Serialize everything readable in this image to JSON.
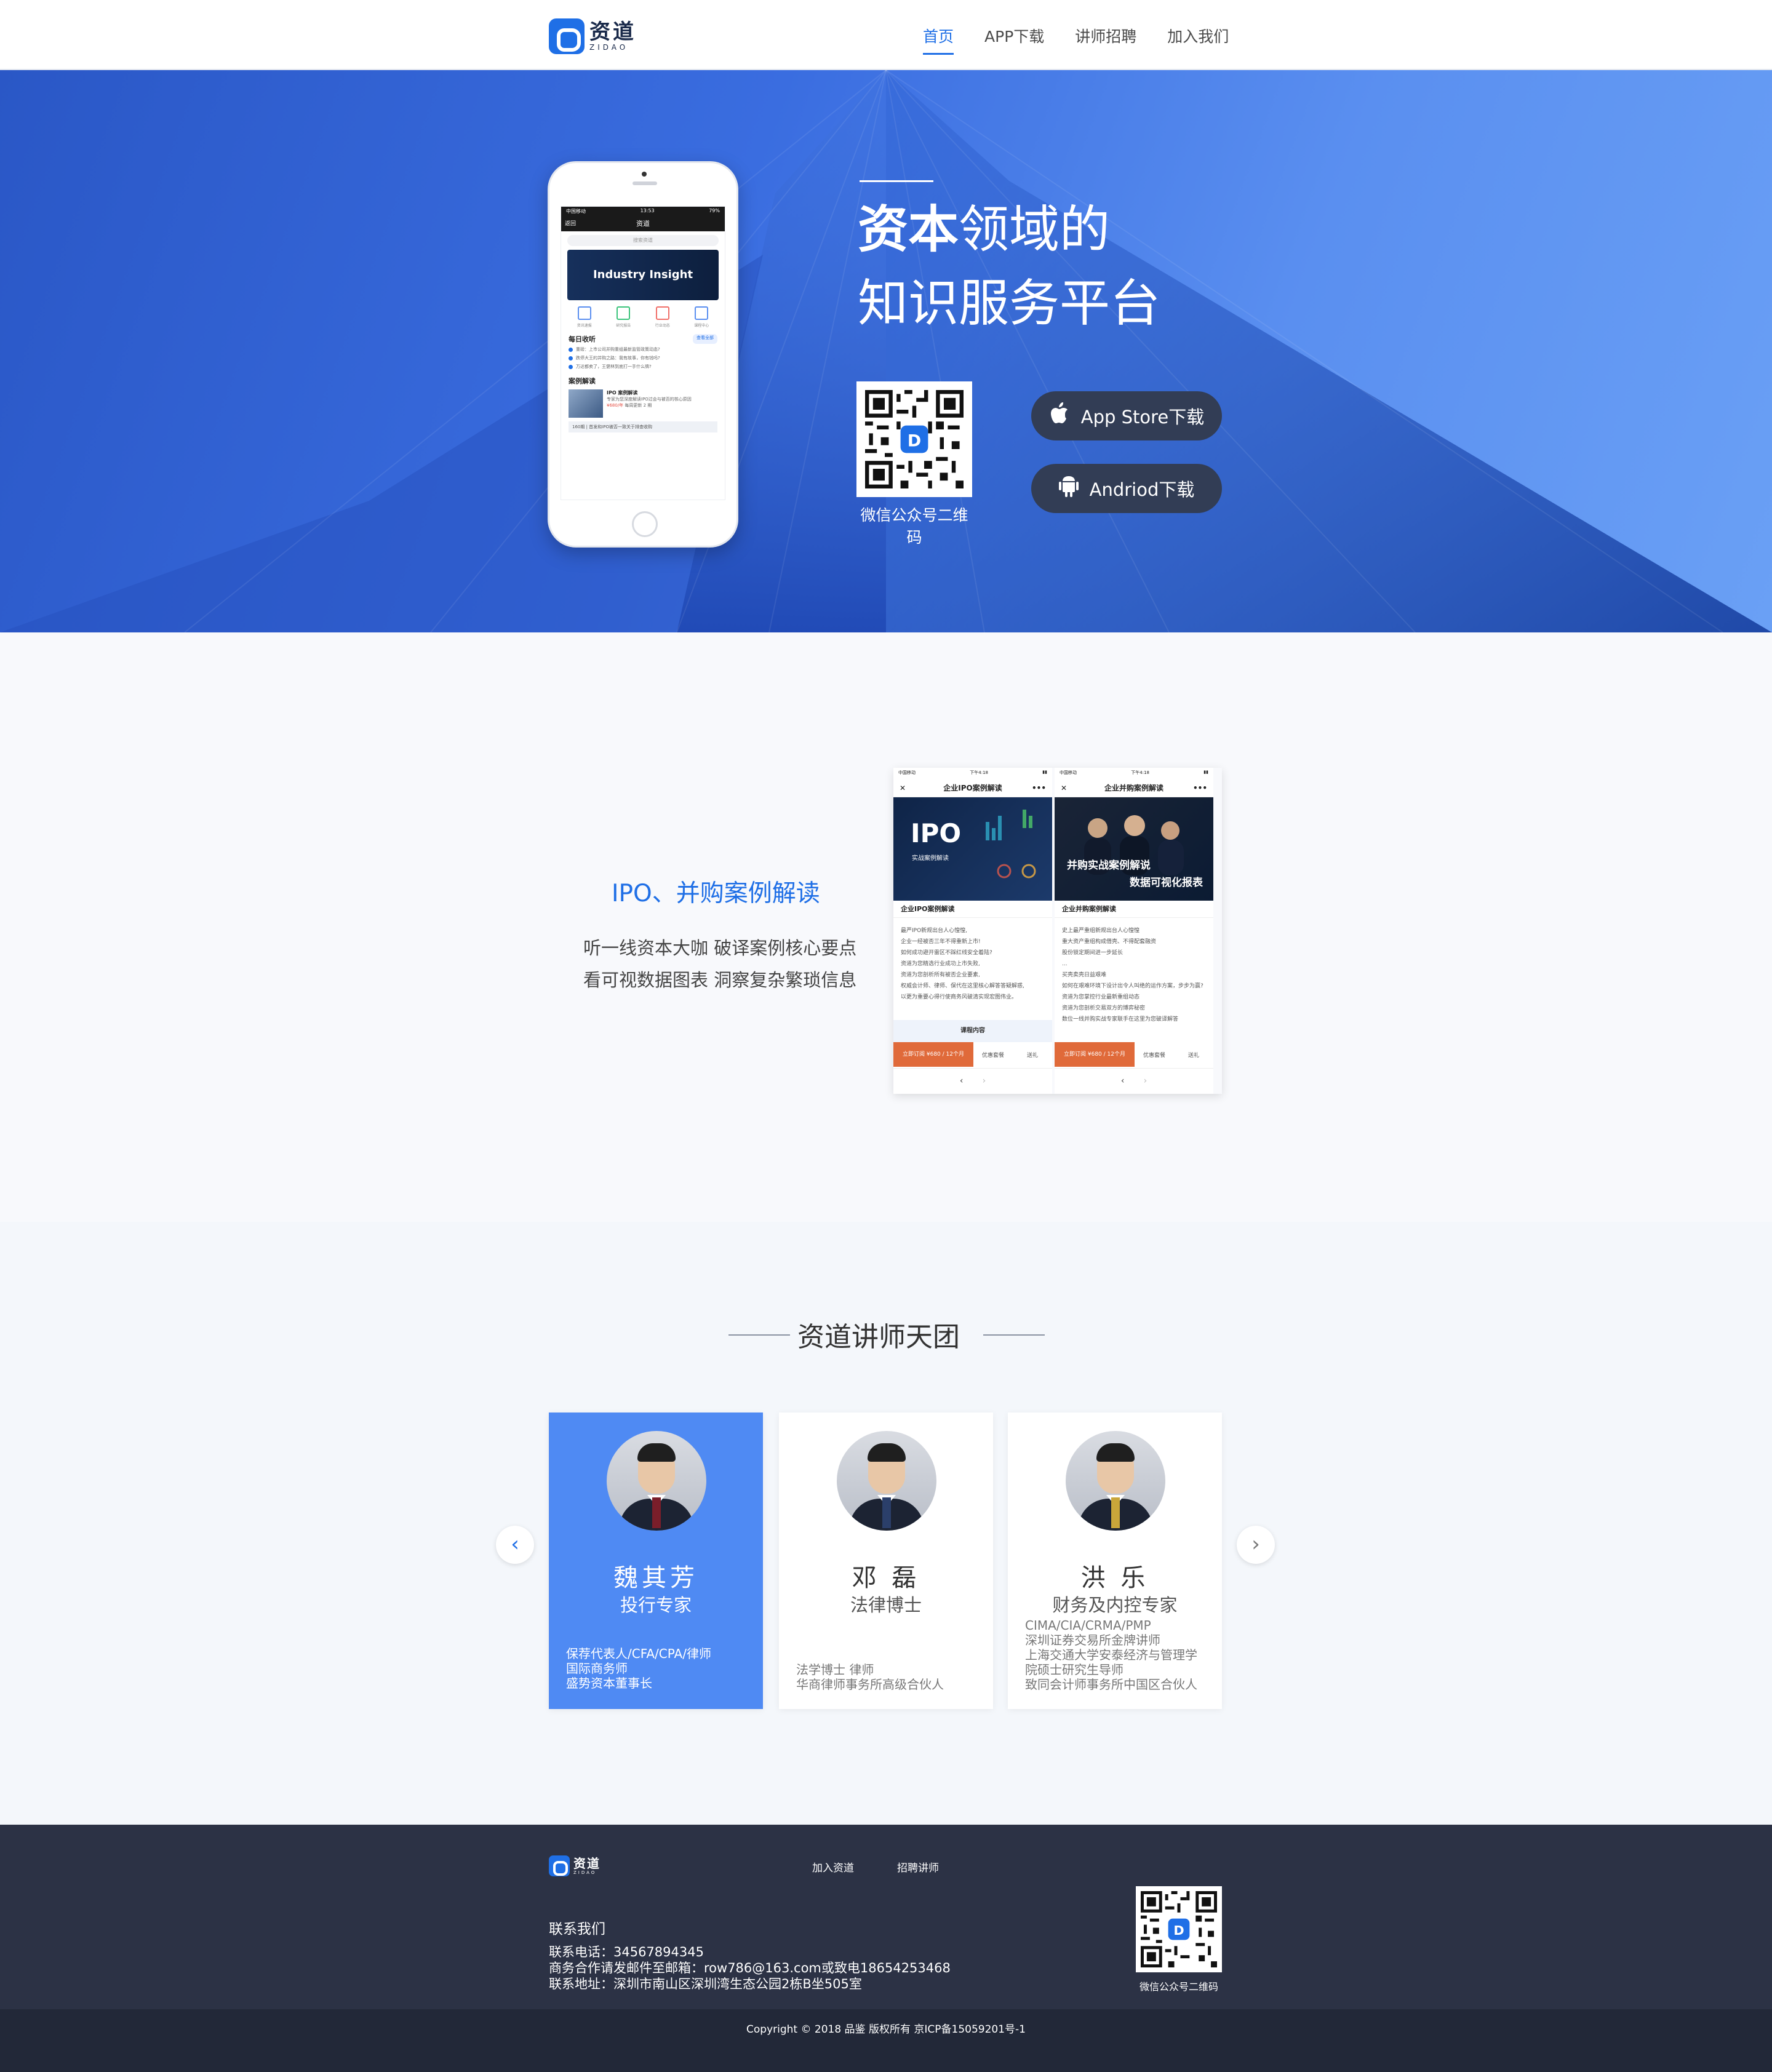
{
  "brand": {
    "name_cn": "资道",
    "name_en": "ZIDAO"
  },
  "nav": {
    "items": [
      {
        "label": "首页",
        "active": true
      },
      {
        "label": "APP下载"
      },
      {
        "label": "讲师招聘"
      },
      {
        "label": "加入我们"
      }
    ]
  },
  "hero": {
    "title_bold": "资本",
    "title_rest": "领域的",
    "title_line2": "知识服务平台",
    "qr_caption": "微信公众号二维码",
    "ios_button": "App Store下载",
    "android_button": "Andriod下载",
    "phone": {
      "status_left": "中国移动",
      "status_mid": "13:53",
      "status_right": "79%",
      "back": "返回",
      "title": "资道",
      "search_placeholder": "搜索资道",
      "banner": "Industry Insight",
      "icons": [
        "资讯速报",
        "研究报告",
        "行业动态",
        "课程中心"
      ],
      "section1": "每日收听",
      "more": "查看全部",
      "items": [
        "重磅：上市公司并购重组最新监管政策动态?",
        "跌停大王的并购之路：我有故事，你有钱吗?",
        "万达都卖了，王健林到底打一手什么牌?"
      ],
      "section2": "案例解读",
      "case_title": "IPO 案例解读",
      "case_desc": "专家为您深度解读IPO过会与被否的核心原因",
      "case_price": "¥680/年",
      "case_update": "每周更新 2 期",
      "bar": "160期 | 首发和IPO被否一致关于排查收购"
    }
  },
  "section2": {
    "title": "IPO、并购案例解读",
    "line1": "听一线资本大咖  破译案例核心要点",
    "line2": "看可视数据图表  洞察复杂繁琐信息",
    "mock1": {
      "status_left": "中国移动",
      "status_mid": "下午4:18",
      "header": "企业IPO案例解读",
      "banner_big": "IPO",
      "banner_sub": "实战案例解读",
      "subtitle": "企业IPO案例解读",
      "body": [
        "最严IPO新规出台人心惶惶,",
        "企业一经被否三年不得重新上市!",
        "如何成功避开雷区不踩红线安全着陆?",
        "资道为您精选行业成功上市失败,",
        "资道为您剖析所有被否企业要素,",
        "权威会计师、律师、保代在这里核心解答答疑解惑,",
        "以更为重要心得行使商务风破清实现宏图伟业。"
      ],
      "course": "课程内容",
      "buy": "立即订阅 ¥680 / 12个月",
      "coupon": "优惠套餐",
      "gift": "送礼"
    },
    "mock2": {
      "status_left": "中国移动",
      "status_mid": "下午4:18",
      "header": "企业并购案例解读",
      "banner_line1": "并购实战案例解说",
      "banner_line2": "数据可视化报表",
      "subtitle": "企业并购案例解读",
      "body": [
        "史上最严重组新规出台人心惶惶",
        "重大资产重组构成借壳、不得配套融资",
        "股份锁定期间进一步延长",
        "...",
        "买壳卖壳日益艰难",
        "如何在艰难环境下设计出令人叫绝的运作方案，步步为赢?",
        "资道为您掌控行业最新重组动态",
        "资道为您剖析交易双方的博弈秘密",
        "数位一线并购实战专家联手在这里为您破译解答"
      ],
      "buy": "立即订阅 ¥680 / 12个月",
      "coupon": "优惠套餐",
      "gift": "送礼"
    }
  },
  "section3": {
    "title": "资道讲师天团",
    "lecturers": [
      {
        "name": "魏其芳",
        "role": "投行专家",
        "desc": [
          "保荐代表人/CFA/CPA/律师",
          "国际商务师",
          "盛势资本董事长"
        ]
      },
      {
        "name": "邓 磊",
        "role": "法律博士",
        "desc": [
          "法学博士 律师",
          "华商律师事务所高级合伙人"
        ]
      },
      {
        "name": "洪 乐",
        "role": "财务及内控专家",
        "desc": [
          "CIMA/CIA/CRMA/PMP",
          "深圳证券交易所金牌讲师",
          "上海交通大学安泰经济与管理学",
          "院硕士研究生导师",
          "致同会计师事务所中国区合伙人"
        ]
      }
    ]
  },
  "footer": {
    "links": [
      "加入资道",
      "招聘讲师"
    ],
    "contact_title": "联系我们",
    "phone": "联系电话：34567894345",
    "email": "商务合作请发邮件至邮箱：row786@163.com或致电18654253468",
    "address": "联系地址：深圳市南山区深圳湾生态公园2栋B坐505室",
    "qr_caption": "微信公众号二维码",
    "copyright": "Copyright © 2018 品鉴 版权所有 京ICP备15059201号-1"
  },
  "colors": {
    "accent": "#1f6fe6",
    "hero_start": "#2a57c6",
    "hero_end": "#6aa0f5",
    "footer": "#2c3245",
    "card_active": "#4f8af3",
    "store_button": "#323d55"
  }
}
